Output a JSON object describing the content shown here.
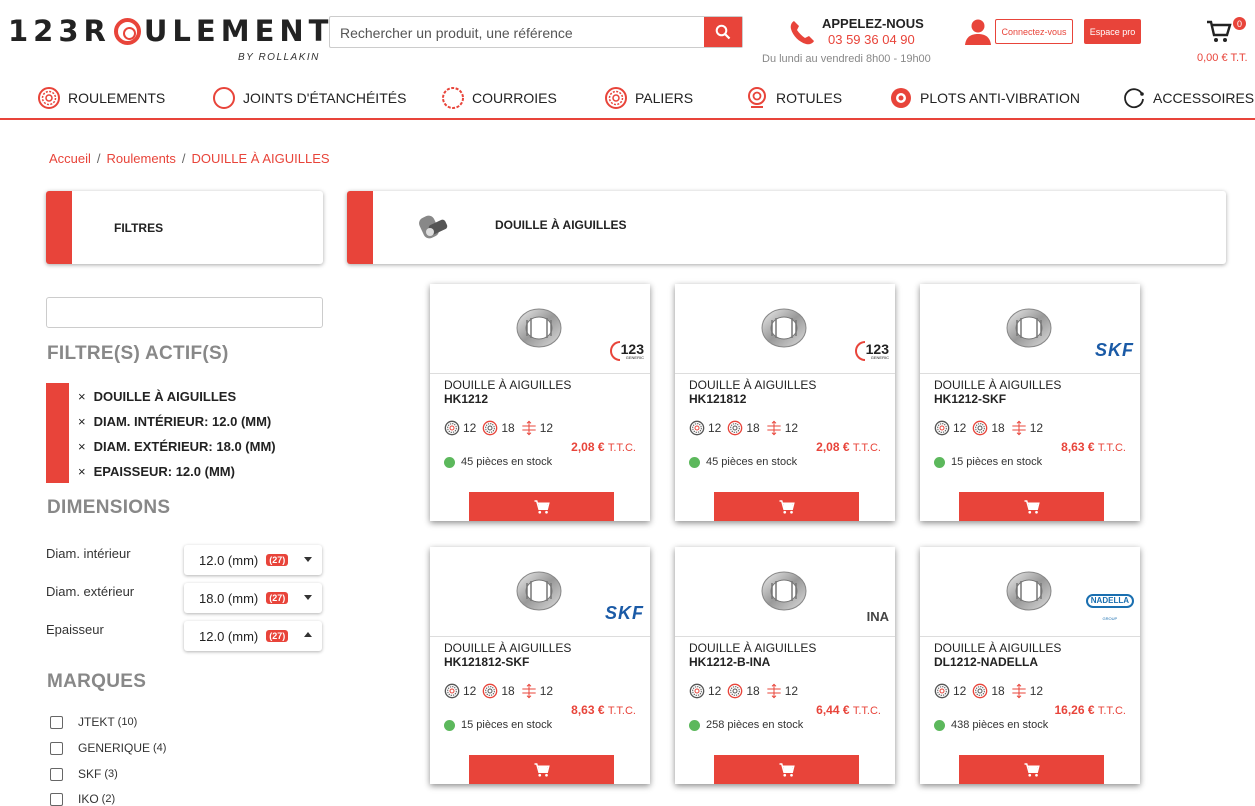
{
  "header": {
    "logo_text": "123ROULEMENT",
    "logo_sub": "BY ROLLAKIN",
    "search_placeholder": "Rechercher un produit, une référence",
    "call_title": "APPELEZ-NOUS",
    "call_number": "03 59 36 04 90",
    "call_hours": "Du lundi au vendredi 8h00 - 19h00",
    "login_label": "Connectez-vous",
    "pro_label": "Espace pro",
    "cart_count": "0",
    "cart_total": "0,00 € T.T."
  },
  "nav": [
    {
      "label": "ROULEMENTS",
      "icon": "bearing-icon"
    },
    {
      "label": "JOINTS D'ÉTANCHÉITÉS",
      "icon": "seal-icon"
    },
    {
      "label": "COURROIES",
      "icon": "belt-icon"
    },
    {
      "label": "PALIERS",
      "icon": "bearing-unit-icon"
    },
    {
      "label": "ROTULES",
      "icon": "rod-end-icon"
    },
    {
      "label": "PLOTS ANTI-VIBRATION",
      "icon": "anti-vibration-icon"
    },
    {
      "label": "ACCESSOIRES",
      "icon": "accessories-icon"
    }
  ],
  "breadcrumb": [
    "Accueil",
    "Roulements",
    "DOUILLE À AIGUILLES"
  ],
  "filters": {
    "title": "FILTRES",
    "active_title": "FILTRE(S) ACTIF(S)",
    "active": [
      "DOUILLE À AIGUILLES",
      "DIAM. INTÉRIEUR: 12.0 (MM)",
      "DIAM. EXTÉRIEUR: 18.0 (MM)",
      "EPAISSEUR: 12.0 (MM)"
    ],
    "dimensions_title": "DIMENSIONS",
    "dimensions": [
      {
        "label": "Diam. intérieur",
        "value": "12.0 (mm)",
        "count": "(27)",
        "state": "collapsed"
      },
      {
        "label": "Diam. extérieur",
        "value": "18.0 (mm)",
        "count": "(27)",
        "state": "collapsed"
      },
      {
        "label": "Epaisseur",
        "value": "12.0 (mm)",
        "count": "(27)",
        "state": "expanded"
      }
    ],
    "brands_title": "MARQUES",
    "brands": [
      {
        "name": "JTEKT",
        "count": "(10)"
      },
      {
        "name": "GENERIQUE",
        "count": "(4)"
      },
      {
        "name": "SKF",
        "count": "(3)"
      },
      {
        "name": "IKO",
        "count": "(2)"
      }
    ]
  },
  "category": {
    "title": "DOUILLE À AIGUILLES"
  },
  "products": [
    {
      "type": "DOUILLE À AIGUILLES",
      "ref": "HK1212",
      "d_in": "12",
      "d_out": "18",
      "width": "12",
      "price": "2,08 €",
      "ttc": "T.T.C.",
      "stock": "45 pièces en stock",
      "brand": "123",
      "brand_sub": "GENERIC"
    },
    {
      "type": "DOUILLE À AIGUILLES",
      "ref": "HK121812",
      "d_in": "12",
      "d_out": "18",
      "width": "12",
      "price": "2,08 €",
      "ttc": "T.T.C.",
      "stock": "45 pièces en stock",
      "brand": "123",
      "brand_sub": "GENERIC"
    },
    {
      "type": "DOUILLE À AIGUILLES",
      "ref": "HK1212-SKF",
      "d_in": "12",
      "d_out": "18",
      "width": "12",
      "price": "8,63 €",
      "ttc": "T.T.C.",
      "stock": "15 pièces en stock",
      "brand": "SKF"
    },
    {
      "type": "DOUILLE À AIGUILLES",
      "ref": "HK121812-SKF",
      "d_in": "12",
      "d_out": "18",
      "width": "12",
      "price": "8,63 €",
      "ttc": "T.T.C.",
      "stock": "15 pièces en stock",
      "brand": "SKF"
    },
    {
      "type": "DOUILLE À AIGUILLES",
      "ref": "HK1212-B-INA",
      "d_in": "12",
      "d_out": "18",
      "width": "12",
      "price": "6,44 €",
      "ttc": "T.T.C.",
      "stock": "258 pièces en stock",
      "brand": "INA"
    },
    {
      "type": "DOUILLE À AIGUILLES",
      "ref": "DL1212-NADELLA",
      "d_in": "12",
      "d_out": "18",
      "width": "12",
      "price": "16,26 €",
      "ttc": "T.T.C.",
      "stock": "438 pièces en stock",
      "brand": "NADELLA",
      "brand_sub": "GROUP"
    }
  ],
  "colors": {
    "accent": "#e8443a",
    "stock_ok": "#5cb85c"
  }
}
